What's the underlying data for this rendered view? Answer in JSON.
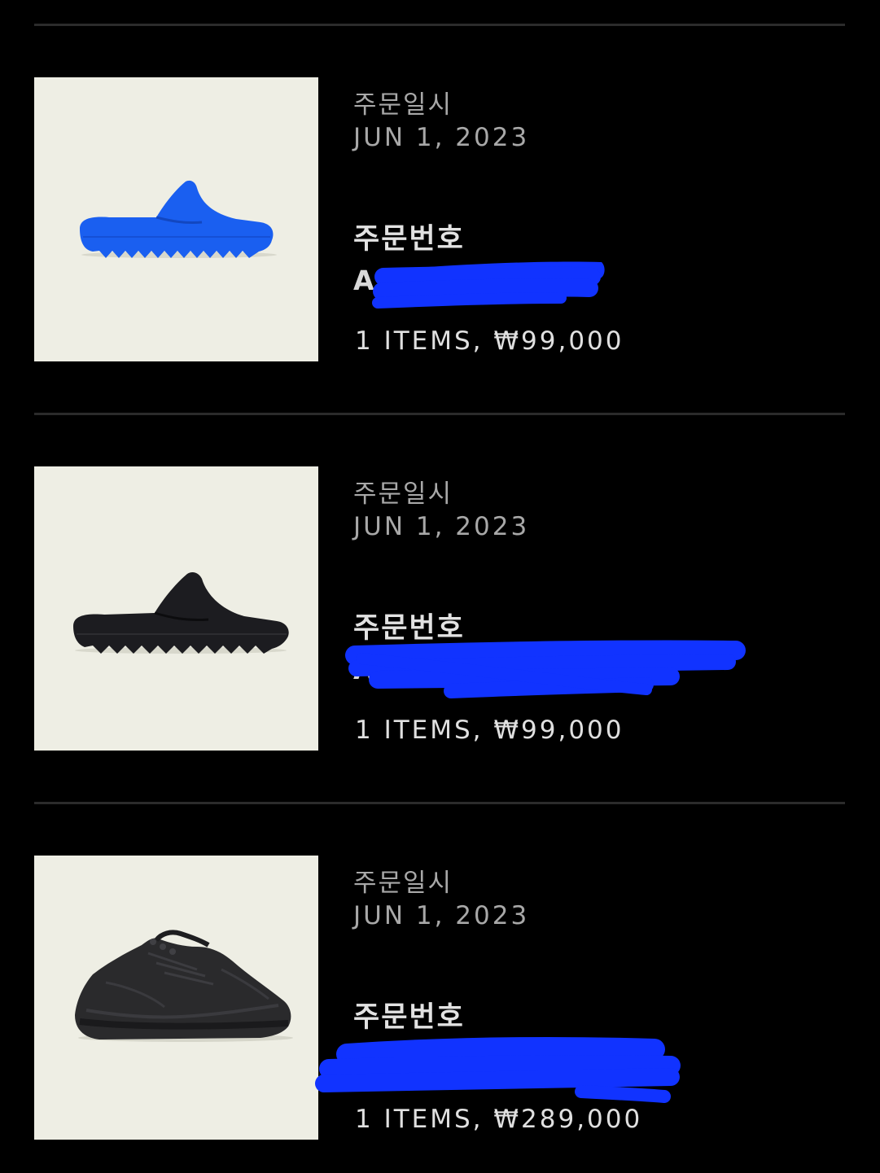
{
  "orders": [
    {
      "product_icon": "blue-slide-sandal-icon",
      "product_color": "#1a5ff0",
      "date_label": "주문일시",
      "date_value": "JUN 1, 2023",
      "number_label": "주문번호",
      "number_value": "A",
      "summary": "1 ITEMS, ₩99,000"
    },
    {
      "product_icon": "black-slide-sandal-icon",
      "product_color": "#1c1c20",
      "date_label": "주문일시",
      "date_value": "JUN 1, 2023",
      "number_label": "주문번호",
      "number_value": "A",
      "summary": "1 ITEMS, ₩99,000"
    },
    {
      "product_icon": "black-sneaker-icon",
      "product_color": "#2a2a2c",
      "date_label": "주문일시",
      "date_value": "JUN 1, 2023",
      "number_label": "주문번호",
      "number_value": "",
      "summary": "1 ITEMS, ₩289,000"
    }
  ],
  "colors": {
    "background": "#000000",
    "divider": "#2b2b2b",
    "thumbnail_bg": "#eeeee4",
    "redaction": "#1133ff"
  }
}
